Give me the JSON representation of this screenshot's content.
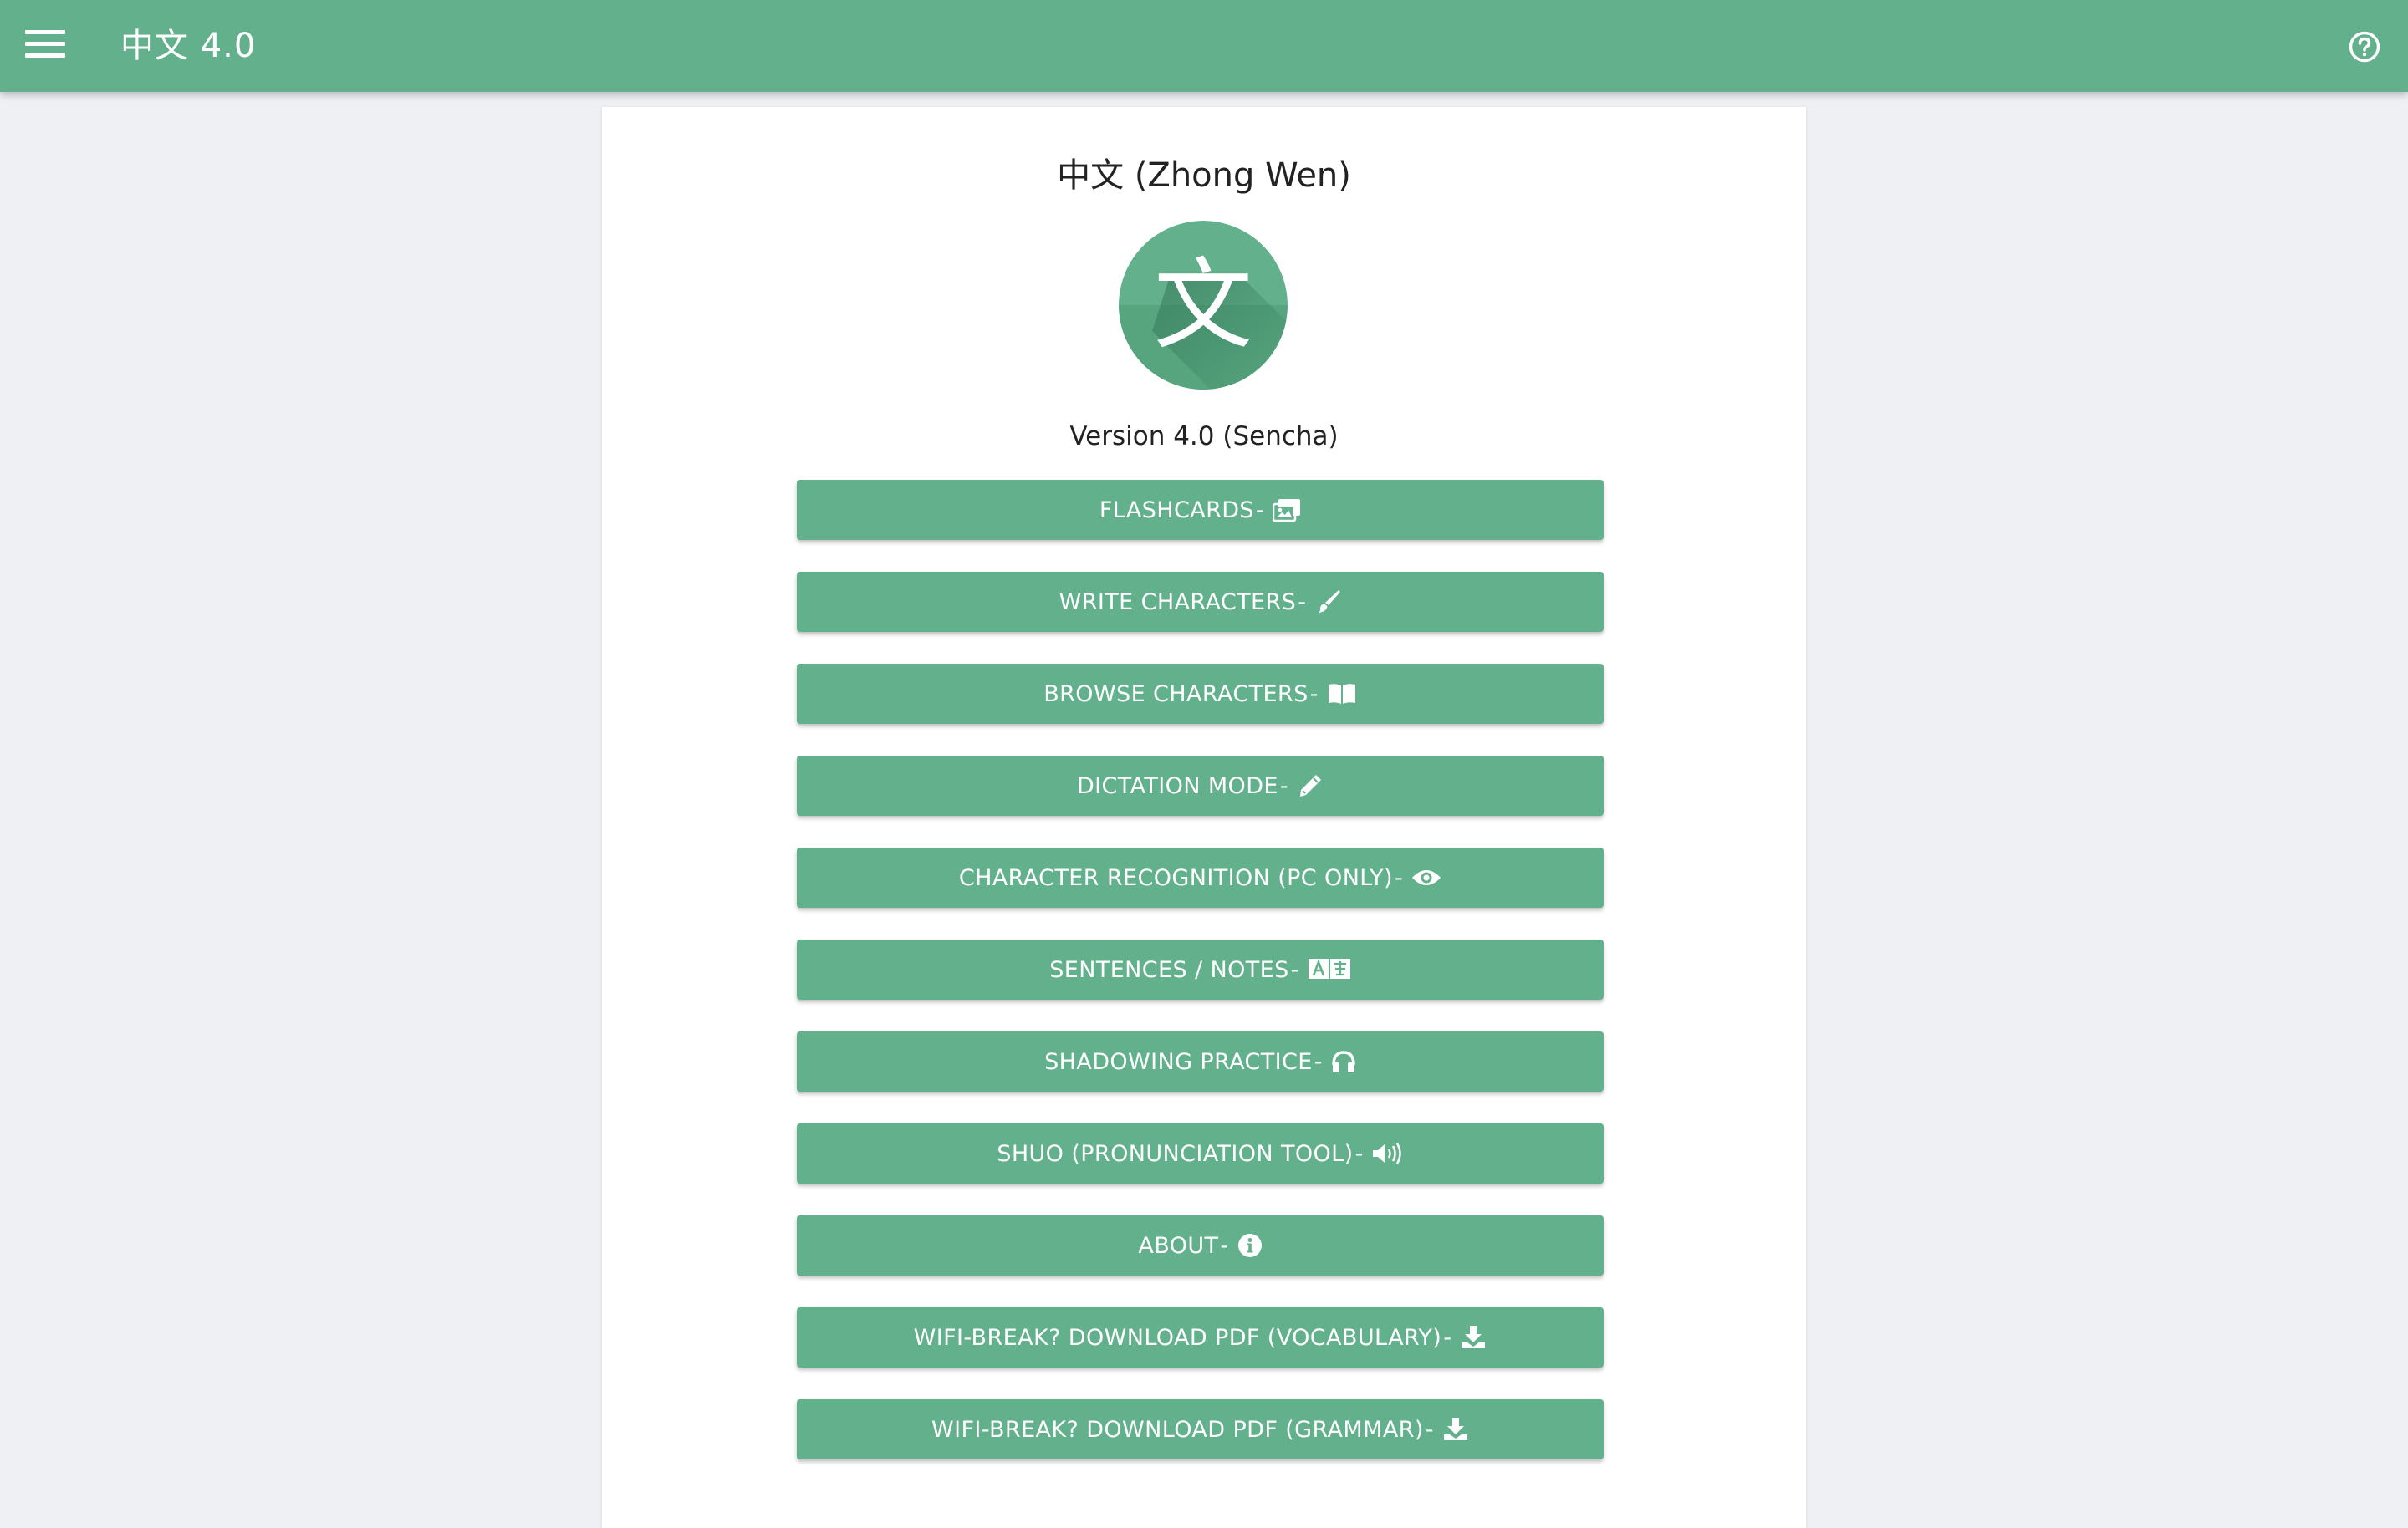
{
  "header": {
    "app_title": "中文 4.0",
    "menu_icon": "hamburger-menu-icon",
    "help_icon": "help-circle-icon"
  },
  "card": {
    "title": "中文 (Zhong Wen)",
    "logo_glyph": "文",
    "version": "Version 4.0 (Sencha)"
  },
  "menu": {
    "separator": "-",
    "items": [
      {
        "label": "FLASHCARDS",
        "icon": "images-icon"
      },
      {
        "label": "WRITE CHARACTERS",
        "icon": "paintbrush-icon"
      },
      {
        "label": "BROWSE CHARACTERS",
        "icon": "open-book-icon"
      },
      {
        "label": "DICTATION MODE",
        "icon": "pencil-icon"
      },
      {
        "label": "CHARACTER RECOGNITION (PC ONLY)",
        "icon": "eye-icon"
      },
      {
        "label": "SENTENCES / NOTES",
        "icon": "translate-icon"
      },
      {
        "label": "SHADOWING PRACTICE",
        "icon": "headphones-icon"
      },
      {
        "label": "SHUO (PRONUNCIATION TOOL)",
        "icon": "volume-icon"
      },
      {
        "label": "ABOUT",
        "icon": "info-icon"
      },
      {
        "label": "WIFI-BREAK? DOWNLOAD PDF (VOCABULARY)",
        "icon": "download-icon"
      },
      {
        "label": "WIFI-BREAK? DOWNLOAD PDF (GRAMMAR)",
        "icon": "download-icon"
      }
    ]
  },
  "colors": {
    "primary": "#62b18c",
    "background": "#eef0f3",
    "card": "#ffffff",
    "text": "#222222"
  }
}
